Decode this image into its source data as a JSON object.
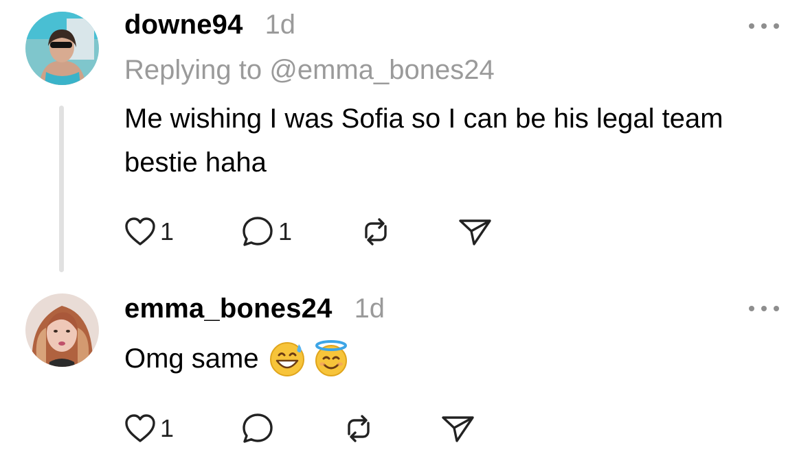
{
  "posts": [
    {
      "username": "downe94",
      "time": "1d",
      "reply_to": "Replying to @emma_bones24",
      "text": "Me wishing I was Sofia so I can be his legal team bestie haha",
      "likes": "1",
      "replies": "1",
      "avatar": "woman-sunglasses-pool-avatar"
    },
    {
      "username": "emma_bones24",
      "time": "1d",
      "text": "Omg same",
      "emojis": [
        "grinning-face-with-sweat",
        "smiling-face-with-halo"
      ],
      "likes": "1",
      "replies": "",
      "avatar": "woman-red-hair-avatar"
    }
  ],
  "icons": [
    "heart-icon",
    "comment-icon",
    "repost-icon",
    "share-icon",
    "more-icon"
  ],
  "colors": {
    "text": "#000000",
    "secondary": "#9a9a9a",
    "thread_line": "#e1e1e1"
  }
}
